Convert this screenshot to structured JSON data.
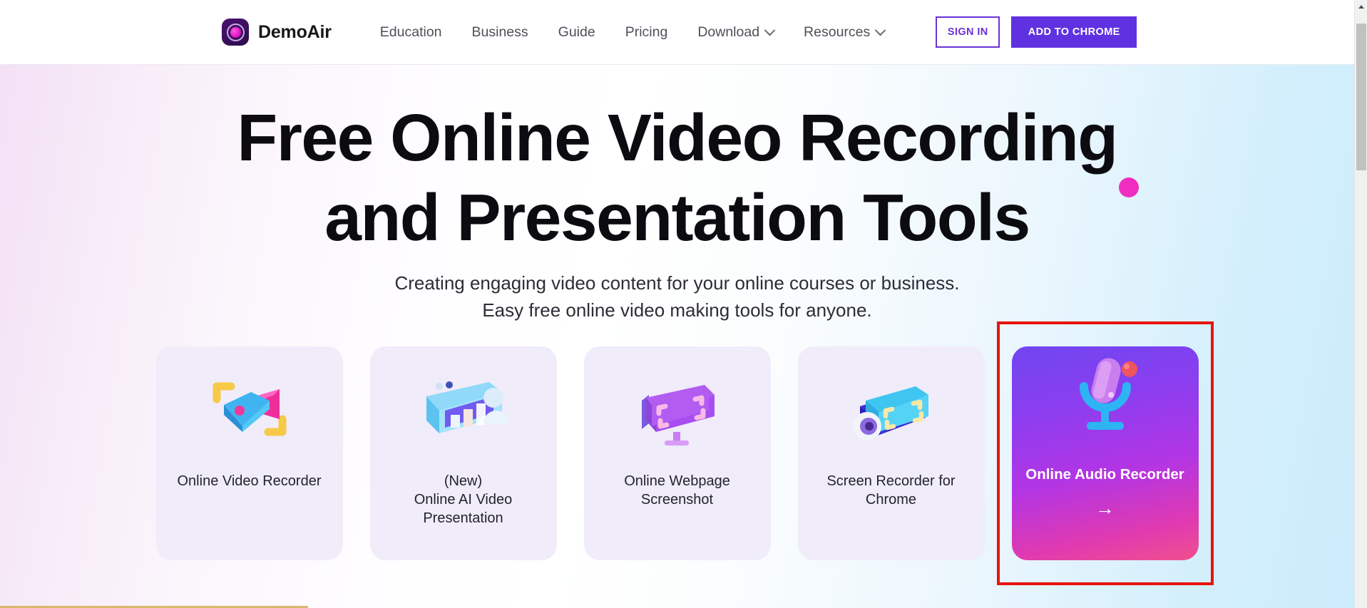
{
  "nav": {
    "brand": "DemoAir",
    "links": [
      {
        "label": "Education",
        "has_caret": false
      },
      {
        "label": "Business",
        "has_caret": false
      },
      {
        "label": "Guide",
        "has_caret": false
      },
      {
        "label": "Pricing",
        "has_caret": false
      },
      {
        "label": "Download",
        "has_caret": true
      },
      {
        "label": "Resources",
        "has_caret": true
      }
    ],
    "sign_in_label": "SIGN IN",
    "add_to_chrome_label": "ADD TO CHROME"
  },
  "hero": {
    "headline_line1": "Free Online Video Recording",
    "headline_line2": "and Presentation Tools",
    "subhead_line1": "Creating engaging video content for your online courses or business.",
    "subhead_line2": "Easy free online video making tools for anyone."
  },
  "cards": [
    {
      "label": "Online Video Recorder",
      "label_line2": "",
      "icon": "video-camera-3d-icon"
    },
    {
      "label": "(New)",
      "label_line2": "Online AI Video Presentation",
      "icon": "presentation-board-3d-icon"
    },
    {
      "label": "Online Webpage Screenshot",
      "label_line2": "",
      "icon": "monitor-screenshot-3d-icon"
    },
    {
      "label": "Screen Recorder for Chrome",
      "label_line2": "",
      "icon": "webcam-screen-3d-icon"
    }
  ],
  "featured_card": {
    "label": "Online Audio Recorder",
    "icon": "microphone-3d-icon",
    "arrow": "→",
    "highlighted": true
  },
  "colors": {
    "brand_purple": "#6031e0",
    "outline_purple": "#6b32d6",
    "accent_pink": "#ef2ec0",
    "highlight_red": "#e8130f",
    "card_bg": "#f0ecfa"
  }
}
